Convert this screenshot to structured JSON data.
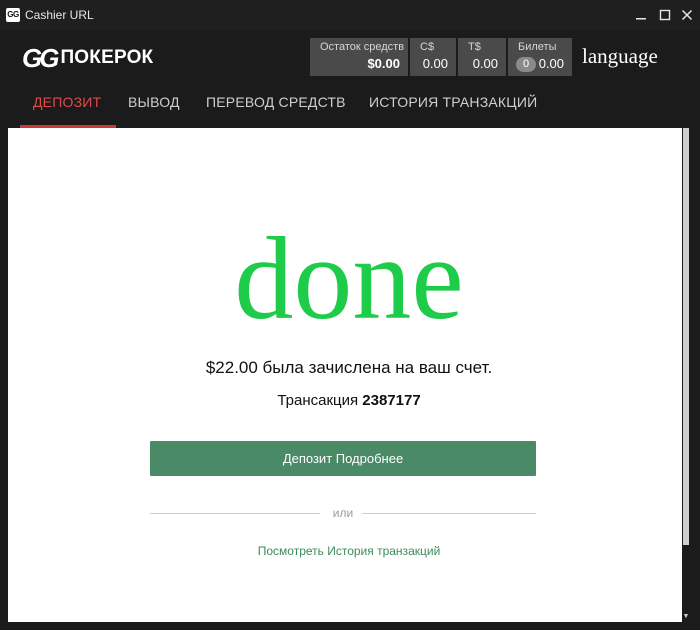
{
  "window": {
    "title": "Cashier URL",
    "icon_text": "GG",
    "controls": [
      "minimize-icon",
      "maximize-icon",
      "close-icon"
    ]
  },
  "header": {
    "logo": {
      "mark": "GG",
      "text": "ПОКЕРОК"
    },
    "balances": [
      {
        "label": "Остаток средств",
        "value": "$0.00"
      },
      {
        "label": "C$",
        "value": "0.00"
      },
      {
        "label": "T$",
        "value": "0.00"
      },
      {
        "label": "Билеты",
        "badge": "0",
        "value": "0.00"
      }
    ],
    "language": "language"
  },
  "tabs": [
    {
      "label": "ДЕПОЗИТ",
      "active": true
    },
    {
      "label": "ВЫВОД",
      "active": false
    },
    {
      "label": "ПЕРЕВОД СРЕДСТВ",
      "active": false
    },
    {
      "label": "ИСТОРИЯ ТРАНЗАКЦИЙ",
      "active": false
    }
  ],
  "result": {
    "status_word": "done",
    "credited_message": "$22.00 была зачислена на ваш счет.",
    "transaction_label": "Трансакция",
    "transaction_id": "2387177",
    "details_button": "Депозит Подробнее",
    "or_text": "или",
    "history_link": "Посмотреть История транзакций"
  },
  "colors": {
    "accent_red": "#c9393a",
    "success_green": "#1fcc4a",
    "button_green": "#4a8a66",
    "link_green": "#3f8a5f",
    "chrome_dark": "#1b1b1b"
  }
}
